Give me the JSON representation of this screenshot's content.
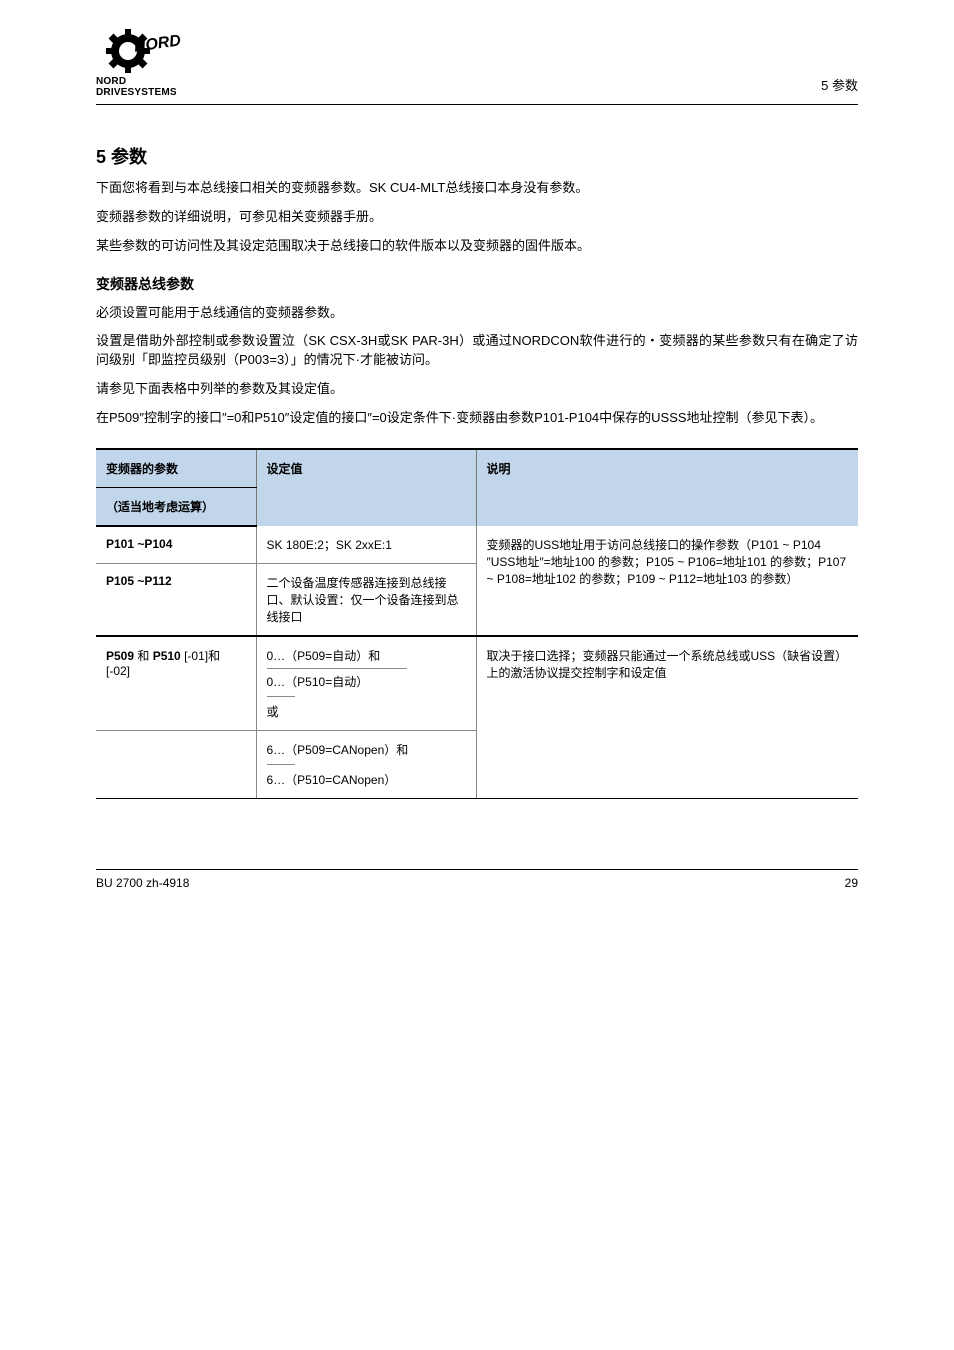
{
  "header": {
    "right": "5 参数",
    "logo_alt": "NORD DRIVESYSTEMS"
  },
  "title": "5   参数",
  "intro": {
    "p1": "下面您将看到与本总线接口相关的变频器参数。SK CU4-MLT总线接口本身没有参数。",
    "p2": "变频器参数的详细说明，可参见相关变频器手册。",
    "p3": "某些参数的可访问性及其设定范围取决于总线接口的软件版本以及变频器的固件版本。"
  },
  "section_bus": {
    "title": "变频器总线参数",
    "p1": "必须设置可能用于总线通信的变频器参数。",
    "p2": "设置是借助外部控制或参数设置泣（SK CSX-3H或SK PAR-3H）或通过NORDCON软件进行的・变频器的某些参数只有在确定了访问级别「即监控员级别（P003=3）」的情况下·才能被访问。",
    "p3": "请参见下面表格中列举的参数及其设定值。",
    "p4": "在P509″控制字的接口″=0和P510″设定值的接口″=0设定条件下·变频器由参数P101-P104中保存的USSS地址控制（参见下表）。"
  },
  "table": {
    "headers": {
      "h1_top": "变频器的参数",
      "h1_bottom": "（适当地考虑运算）",
      "h2": "设定值",
      "h3": "说明"
    },
    "rows": [
      {
        "param": "P101 ~P104",
        "setting": "SK 180E:2；SK 2xxE:1",
        "desc": "变频器的USS地址用于访问总线接口的操作参数（P101 ~ P104 ″USS地址″=地址100 的参数；P105 ~ P106=地址101 的参数；P107 ~ P108=地址102 的参数；P109 ~ P112=地址103 的参数）",
        "rowspan_desc": 2
      },
      {
        "param": "P105 ~P112",
        "setting": "二个设备温度传感器连接到总线接口、默认设置：仅一个设备连接到总线接口"
      },
      {
        "param_html": "<b>P509</b> 和 <b>P510</b> [-01]和 [-02]",
        "setting_top": "0…（P509=自动）和",
        "setting_under": "0…（P510=自动）",
        "setting_after": "或",
        "desc": "取决于接口选择；变频器只能通过一个系统总线或USS（缺省设置）上的激活协议提交控制字和设定值",
        "rowspan_desc": 2
      },
      {
        "param": "",
        "setting_top": "6…（P509=CANopen）和",
        "setting_after_small": "6…（P510=CANopen）"
      }
    ]
  },
  "footer": {
    "left": "BU 2700 zh-4918",
    "right": "29"
  }
}
